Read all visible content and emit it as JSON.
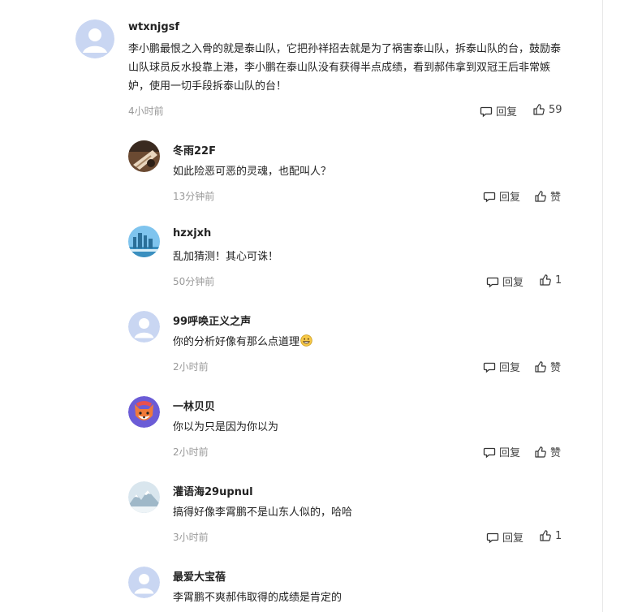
{
  "colors": {
    "text": "#222222",
    "muted": "#999999",
    "avatar_default_bg": "#c9d6f2"
  },
  "top_comment": {
    "username": "wtxnjgsf",
    "content": "李小鹏最恨之入骨的就是泰山队，它把孙祥招去就是为了祸害泰山队，拆泰山队的台，鼓励泰山队球员反水投靠上港，李小鹏在泰山队没有获得半点成绩，看到郝伟拿到双冠王后非常嫉妒，使用一切手段拆泰山队的台！",
    "time": "4小时前",
    "reply_label": "回复",
    "like_label": "59",
    "avatar_icon": "default-user-avatar"
  },
  "replies": [
    {
      "username": "冬雨22F",
      "content": "如此险恶可恶的灵魂，也配叫人？",
      "time": "13分钟前",
      "reply_label": "回复",
      "like_label": "赞",
      "avatar_icon": "photo-avatar"
    },
    {
      "username": "hzxjxh",
      "content": "乱加猜测！其心可诛！",
      "time": "50分钟前",
      "reply_label": "回复",
      "like_label": "1",
      "avatar_icon": "cityscape-avatar"
    },
    {
      "username": "99呼唤正义之声",
      "content": "你的分析好像有那么点道理",
      "time": "2小时前",
      "reply_label": "回复",
      "like_label": "赞",
      "avatar_icon": "default-user-avatar",
      "emoji": "grinning-face-emoji"
    },
    {
      "username": "一林贝贝",
      "content": "你以为只是因为你以为",
      "time": "2小时前",
      "reply_label": "回复",
      "like_label": "赞",
      "avatar_icon": "fox-cartoon-avatar"
    },
    {
      "username": "灌语海29upnul",
      "content": "搞得好像李霄鹏不是山东人似的，哈哈",
      "time": "3小时前",
      "reply_label": "回复",
      "like_label": "1",
      "avatar_icon": "snow-mountain-avatar"
    },
    {
      "username": "最爱大宝蓓",
      "content": "李霄鹏不爽郝伟取得的成绩是肯定的",
      "avatar_icon": "default-user-avatar"
    }
  ]
}
